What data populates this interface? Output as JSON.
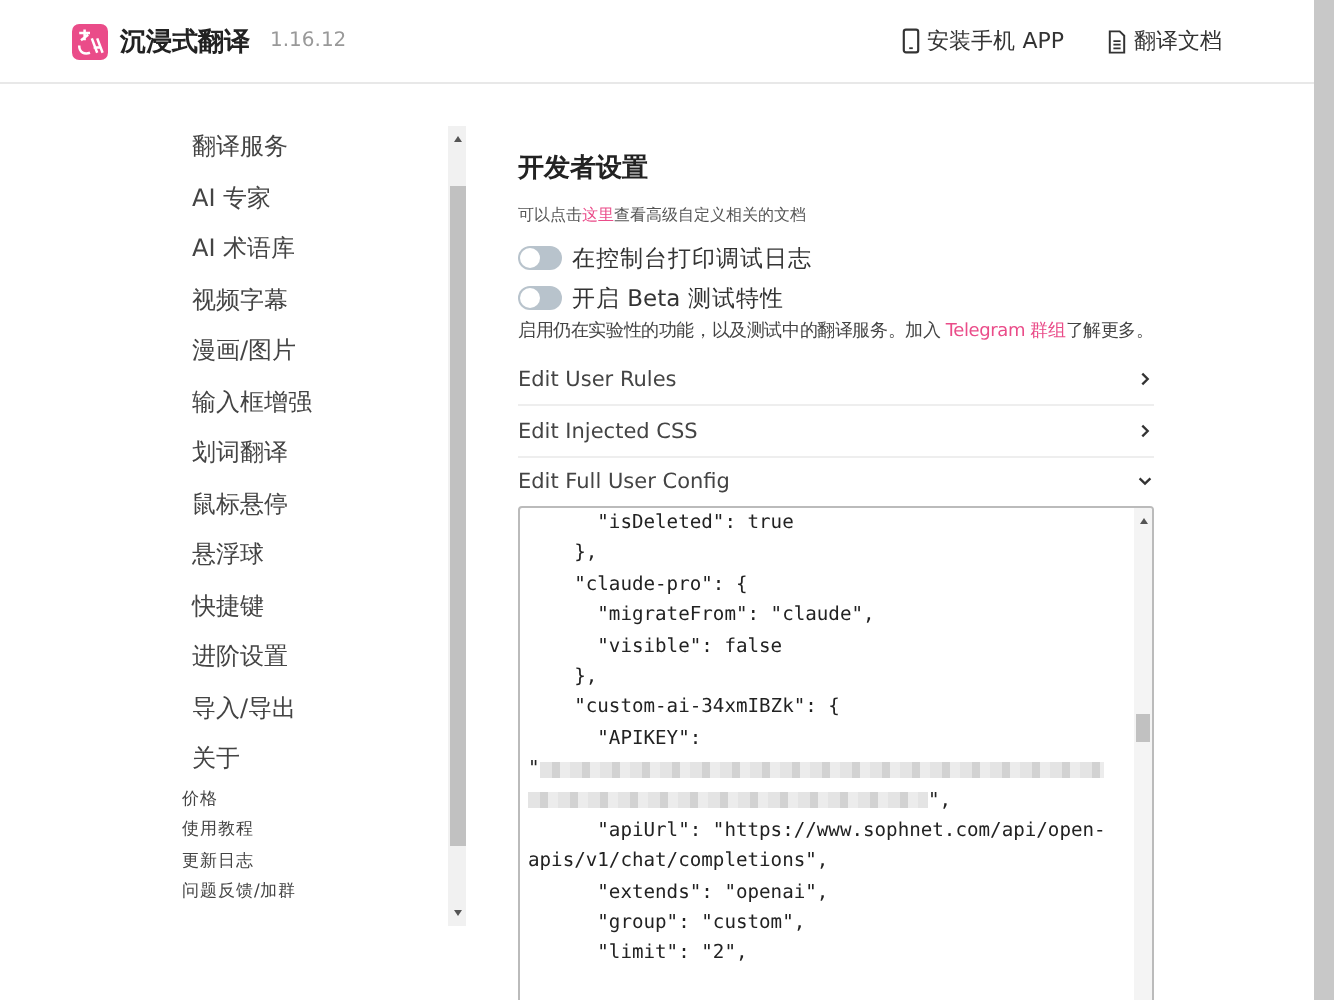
{
  "header": {
    "app_name": "沉浸式翻译",
    "version": "1.16.12",
    "links": [
      {
        "kind": "phone",
        "label": "安装手机 APP"
      },
      {
        "kind": "doc",
        "label": "翻译文档"
      }
    ]
  },
  "sidebar": {
    "items": [
      {
        "label": "翻译服务",
        "kind": "main"
      },
      {
        "label": "AI 专家",
        "kind": "main"
      },
      {
        "label": "AI 术语库",
        "kind": "main"
      },
      {
        "label": "视频字幕",
        "kind": "main"
      },
      {
        "label": "漫画/图片",
        "kind": "main"
      },
      {
        "label": "输入框增强",
        "kind": "main"
      },
      {
        "label": "划词翻译",
        "kind": "main"
      },
      {
        "label": "鼠标悬停",
        "kind": "main"
      },
      {
        "label": "悬浮球",
        "kind": "main"
      },
      {
        "label": "快捷键",
        "kind": "main"
      },
      {
        "label": "进阶设置",
        "kind": "main"
      },
      {
        "label": "导入/导出",
        "kind": "main"
      },
      {
        "label": "关于",
        "kind": "main"
      },
      {
        "label": "价格",
        "kind": "minor"
      },
      {
        "label": "使用教程",
        "kind": "minor"
      },
      {
        "label": "更新日志",
        "kind": "minor"
      },
      {
        "label": "问题反馈/加群",
        "kind": "minor"
      }
    ]
  },
  "section": {
    "title": "开发者设置",
    "doc_hint": {
      "before": "可以点击",
      "link": "这里",
      "after": "查看高级自定义相关的文档"
    },
    "toggles": [
      {
        "label": "在控制台打印调试日志",
        "on": false
      },
      {
        "label": "开启 Beta 测试特性",
        "on": false
      }
    ],
    "beta_note": {
      "before": "启用仍在实验性的功能，以及测试中的翻译服务。加入 ",
      "link": "Telegram 群组",
      "after": "了解更多。"
    },
    "panels": [
      {
        "label": "Edit User Rules",
        "expanded": false
      },
      {
        "label": "Edit Injected CSS",
        "expanded": false
      },
      {
        "label": "Edit Full User Config",
        "expanded": true
      }
    ],
    "config_lines": [
      {
        "kind": "text",
        "text": "      \"isDeleted\": true"
      },
      {
        "kind": "text",
        "text": "    },"
      },
      {
        "kind": "text",
        "text": "    \"claude-pro\": {"
      },
      {
        "kind": "text",
        "text": "      \"migrateFrom\": \"claude\","
      },
      {
        "kind": "text",
        "text": "      \"visible\": false"
      },
      {
        "kind": "text",
        "text": "    },"
      },
      {
        "kind": "text",
        "text": "    \"custom-ai-34xmIBZk\": {"
      },
      {
        "kind": "text",
        "text": "      \"APIKEY\":"
      },
      {
        "kind": "redacted",
        "text": "\""
      },
      {
        "kind": "redacted_end",
        "text": "\","
      },
      {
        "kind": "text",
        "text": "      \"apiUrl\": \"https://www.sophnet.com/api/open-"
      },
      {
        "kind": "text",
        "text": "apis/v1/chat/completions\","
      },
      {
        "kind": "text",
        "text": "      \"extends\": \"openai\","
      },
      {
        "kind": "text",
        "text": "      \"group\": \"custom\","
      },
      {
        "kind": "text",
        "text": "      \"limit\": \"2\","
      }
    ]
  }
}
